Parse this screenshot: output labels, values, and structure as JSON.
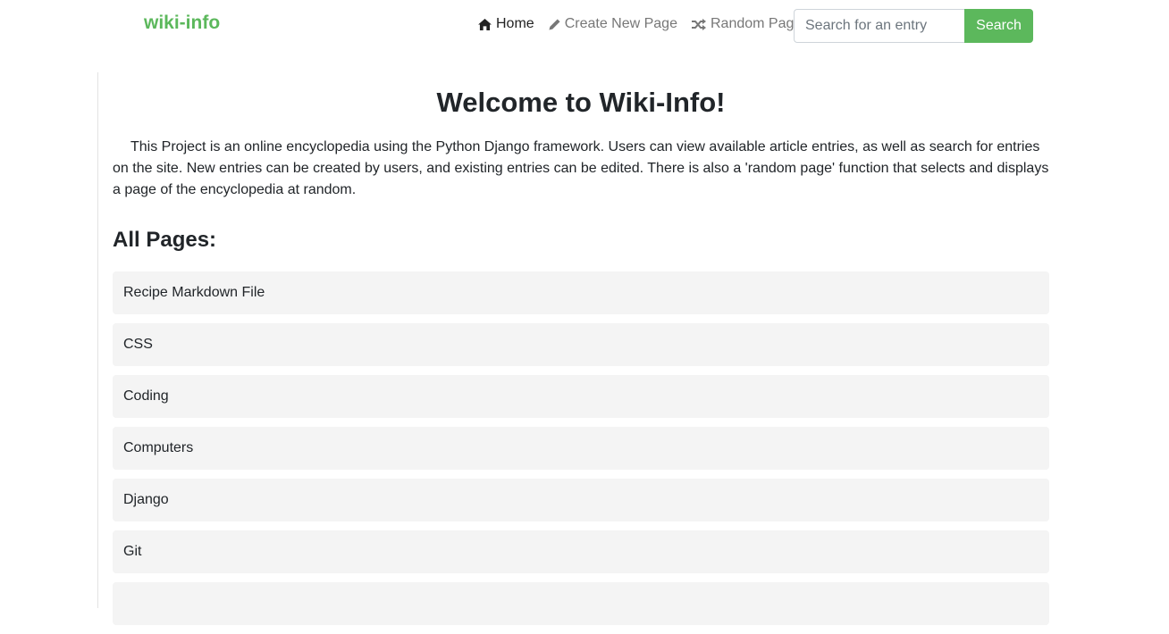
{
  "brand": "wiki-info",
  "nav": {
    "items": [
      {
        "label": "Home",
        "icon": "home-icon"
      },
      {
        "label": "Create New Page",
        "icon": "pencil-icon"
      },
      {
        "label": "Random Page",
        "icon": "shuffle-icon"
      }
    ]
  },
  "search": {
    "placeholder": "Search for an entry",
    "value": "",
    "button_label": "Search"
  },
  "main": {
    "title": "Welcome to Wiki-Info!",
    "intro": "This Project is an online encyclopedia using the Python Django framework. Users can view available article entries, as well as search for entries on the site. New entries can be created by users, and existing entries can be edited. There is also a 'random page' function that selects and displays a page of the encyclopedia at random.",
    "section_title": "All Pages:",
    "pages": [
      "Recipe Markdown File",
      "CSS",
      "Coding",
      "Computers",
      "Django",
      "Git"
    ]
  },
  "colors": {
    "brand": "#5cb85c",
    "nav_active": "#222222",
    "nav_muted": "#777777",
    "list_item_bg": "#f4f4f4"
  }
}
